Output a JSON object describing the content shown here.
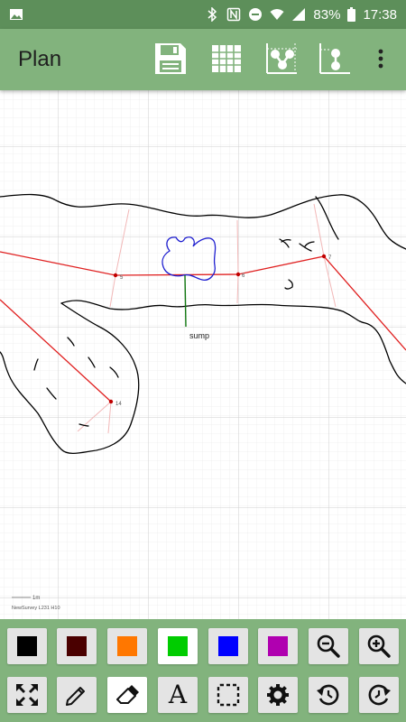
{
  "status_bar": {
    "battery": "83%",
    "time": "17:38"
  },
  "app_bar": {
    "title": "Plan",
    "actions": [
      "save-icon",
      "table-icon",
      "survey-network-icon",
      "elevation-icon",
      "more-vert-icon"
    ]
  },
  "canvas": {
    "station_labels": [
      "5",
      "6",
      "7",
      "14"
    ],
    "annotation": "sump",
    "scale_label": "1m",
    "survey_info": "NewSurvey L231 H10"
  },
  "colors": {
    "statusbar": "#5d8f5a",
    "appbar": "#82b37d",
    "leg": "#e02020",
    "splay": "#f2b8b8",
    "black": "#000000",
    "dark_red": "#4a0000",
    "orange": "#ff7700",
    "green": "#00cc00",
    "blue": "#0000ff",
    "magenta": "#b000b0"
  },
  "toolbar": {
    "row1": [
      "black-swatch",
      "dark-red-swatch",
      "orange-swatch",
      "green-swatch",
      "blue-swatch",
      "magenta-swatch",
      "zoom-out-icon",
      "zoom-in-icon"
    ],
    "row2": [
      "fit-screen-icon",
      "pencil-icon",
      "eraser-icon",
      "text-tool-icon",
      "selection-icon",
      "settings-icon",
      "undo-icon",
      "redo-icon"
    ],
    "text_tool_label": "A",
    "selected_color": "green",
    "selected_tool": "eraser"
  }
}
